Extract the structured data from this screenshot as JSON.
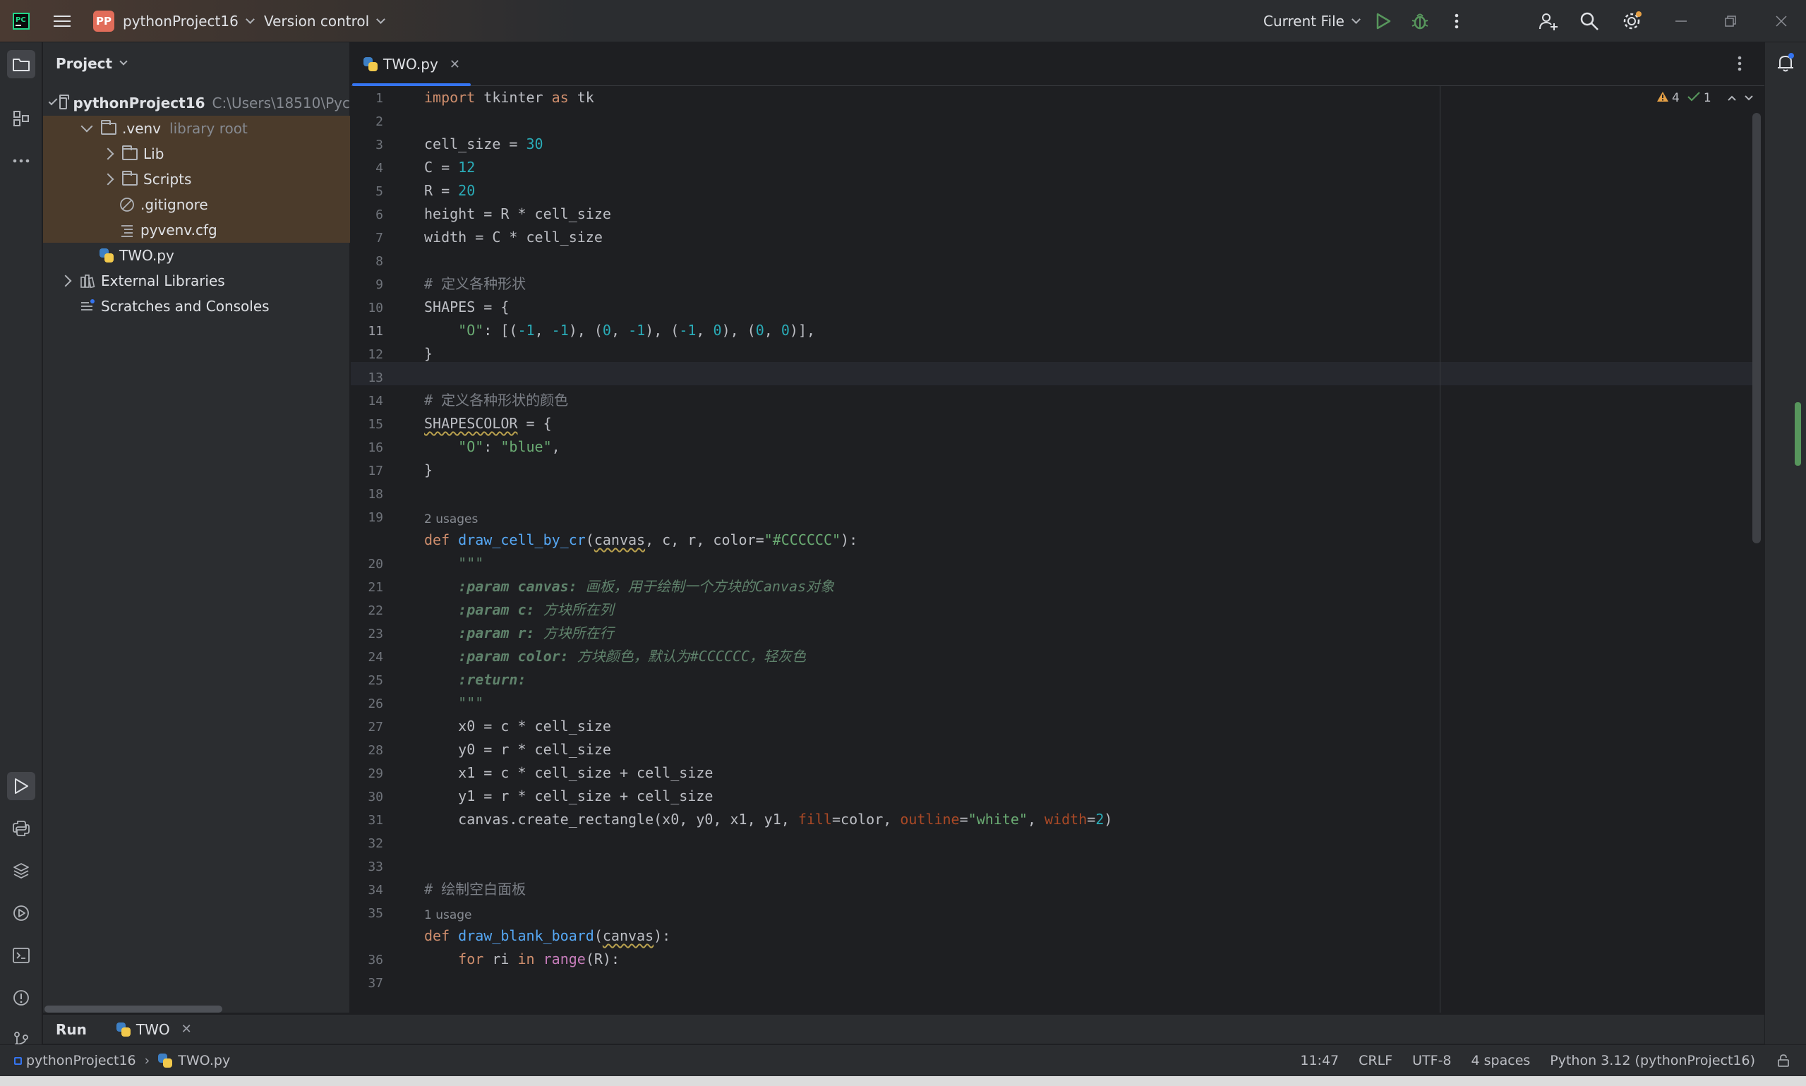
{
  "titlebar": {
    "project_badge": "PP",
    "project_name": "pythonProject16",
    "vcs_label": "Version control",
    "run_config": "Current File"
  },
  "project_panel": {
    "header": "Project",
    "tree": [
      {
        "label": "pythonProject16",
        "extra": "C:\\Users\\18510\\Pyc"
      },
      {
        "label": ".venv",
        "extra": "library root"
      },
      {
        "label": "Lib"
      },
      {
        "label": "Scripts"
      },
      {
        "label": ".gitignore"
      },
      {
        "label": "pyvenv.cfg"
      },
      {
        "label": "TWO.py"
      },
      {
        "label": "External Libraries"
      },
      {
        "label": "Scratches and Consoles"
      }
    ]
  },
  "editor": {
    "tab_label": "TWO.py",
    "warnings": "4",
    "weak_warnings": "1",
    "hints": {
      "usages_2": "2 usages",
      "usages_1": "1 usage"
    },
    "current_line": 11,
    "line_numbers": [
      "1",
      "2",
      "3",
      "4",
      "5",
      "6",
      "7",
      "8",
      "9",
      "10",
      "11",
      "12",
      "13",
      "14",
      "15",
      "16",
      "17",
      "18",
      "19",
      "20",
      "21",
      "22",
      "23",
      "24",
      "25",
      "26",
      "27",
      "28",
      "29",
      "30",
      "31",
      "32",
      "33",
      "34",
      "35",
      "36",
      "37"
    ]
  },
  "code": {
    "l1_kw1": "import",
    "l1_mod": " tkinter ",
    "l1_kw2": "as",
    "l1_alias": " tk",
    "l3_a": "cell_size = ",
    "l3_n": "30",
    "l4_a": "C = ",
    "l4_n": "12",
    "l5_a": "R = ",
    "l5_n": "20",
    "l6": "height = R * cell_size",
    "l7": "width = C * cell_size",
    "l9": "# 定义各种形状",
    "l10": "SHAPES = {",
    "l11_s": "\"O\"",
    "l11_a": ": [(",
    "l11_n1": "-1",
    "l11_b": ", ",
    "l11_n2": "-1",
    "l11_c": "), (",
    "l11_n3": "0",
    "l11_d": ", ",
    "l11_n4": "-1",
    "l11_e": "), (",
    "l11_n5": "-1",
    "l11_f": ", ",
    "l11_n6": "0",
    "l11_g": "), (",
    "l11_n7": "0",
    "l11_h": ", ",
    "l11_n8": "0",
    "l11_i": ")],",
    "l12": "}",
    "l14": "# 定义各种形状的颜色",
    "l15_a": "SHAPESCOLOR",
    "l15_b": " = {",
    "l16_s1": "\"O\"",
    "l16_a": ": ",
    "l16_s2": "\"blue\"",
    "l16_b": ",",
    "l17": "}",
    "l20_kw": "def",
    "l20_fn": "draw_cell_by_cr",
    "l20_a": "(",
    "l20_p": "canvas",
    "l20_b": ", c, r, color=",
    "l20_s": "\"#CCCCCC\"",
    "l20_c": "):",
    "l21": "\"\"\"",
    "l22_t": ":param canvas:",
    "l22_d": " 画板，用于绘制一个方块的Canvas对象",
    "l23_t": ":param c:",
    "l23_d": " 方块所在列",
    "l24_t": ":param r:",
    "l24_d": " 方块所在行",
    "l25_t": ":param color:",
    "l25_d": " 方块颜色，默认为#CCCCCC，轻灰色",
    "l26_t": ":return:",
    "l27": "\"\"\"",
    "l28": "x0 = c * cell_size",
    "l29": "y0 = r * cell_size",
    "l30": "x1 = c * cell_size + cell_size",
    "l31": "y1 = r * cell_size + cell_size",
    "l32_a": "canvas.create_rectangle(x0, y0, x1, y1, ",
    "l32_p1": "fill",
    "l32_b": "=color, ",
    "l32_p2": "outline",
    "l32_c": "=",
    "l32_s": "\"white\"",
    "l32_d": ", ",
    "l32_p3": "width",
    "l32_e": "=",
    "l32_n": "2",
    "l32_f": ")",
    "l35": "# 绘制空白面板",
    "l36_kw": "def",
    "l36_fn": "draw_blank_board",
    "l36_a": "(",
    "l36_p": "canvas",
    "l36_b": "):",
    "l37_kw1": "for",
    "l37_a": " ri ",
    "l37_kw2": "in",
    "l37_sp": " ",
    "l37_fn": "range",
    "l37_b": "(R):"
  },
  "bottom": {
    "run_label": "Run",
    "run_tab": "TWO"
  },
  "statusbar": {
    "breadcrumb_project": "pythonProject16",
    "breadcrumb_file": "TWO.py",
    "position": "11:47",
    "line_sep": "CRLF",
    "encoding": "UTF-8",
    "indent": "4 spaces",
    "interpreter": "Python 3.12 (pythonProject16)"
  }
}
